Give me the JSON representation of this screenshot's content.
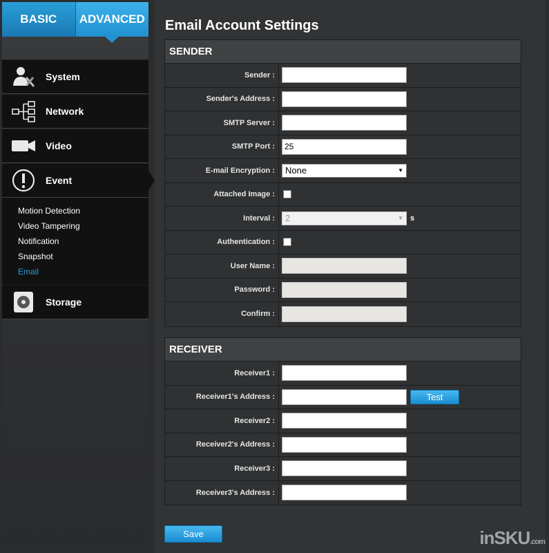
{
  "tabs": {
    "basic": "BASIC",
    "advanced": "ADVANCED"
  },
  "sidebar": {
    "items": [
      {
        "label": "System",
        "icon": "system-icon"
      },
      {
        "label": "Network",
        "icon": "network-icon"
      },
      {
        "label": "Video",
        "icon": "video-icon"
      },
      {
        "label": "Event",
        "icon": "event-icon"
      },
      {
        "label": "Storage",
        "icon": "storage-icon"
      }
    ],
    "event_sub": [
      "Motion Detection",
      "Video Tampering",
      "Notification",
      "Snapshot",
      "Email"
    ]
  },
  "page": {
    "title": "Email Account Settings"
  },
  "sender": {
    "header": "SENDER",
    "labels": {
      "sender": "Sender :",
      "address": "Sender's Address :",
      "smtp_server": "SMTP Server :",
      "smtp_port": "SMTP Port :",
      "encryption": "E-mail Encryption :",
      "attached": "Attached Image :",
      "interval": "Interval :",
      "auth": "Authentication :",
      "user": "User Name :",
      "password": "Password :",
      "confirm": "Confirm :"
    },
    "values": {
      "sender": "",
      "address": "",
      "smtp_server": "",
      "smtp_port": "25",
      "encryption": "None",
      "attached_checked": false,
      "interval": "2",
      "interval_unit": "s",
      "auth_checked": false,
      "user": "",
      "password": "",
      "confirm": ""
    }
  },
  "receiver": {
    "header": "RECEIVER",
    "labels": {
      "r1": "Receiver1 :",
      "r1_addr": "Receiver1's Address :",
      "r2": "Receiver2 :",
      "r2_addr": "Receiver2's Address :",
      "r3": "Receiver3 :",
      "r3_addr": "Receiver3's Address :"
    },
    "test_button": "Test"
  },
  "save_button": "Save",
  "watermark": {
    "main": "inSKU",
    "suffix": ".com"
  },
  "colors": {
    "accent": "#2291d0",
    "active_link": "#2c9be0"
  }
}
